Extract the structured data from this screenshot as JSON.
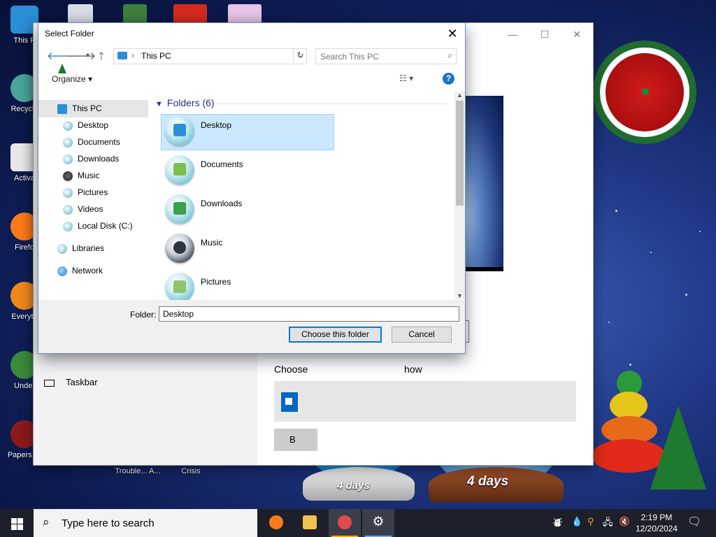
{
  "desktop": {
    "icons": [
      {
        "label": "This P",
        "color": "#2a8fd6"
      },
      {
        "label": "Recycle",
        "color": "#4aa59a"
      },
      {
        "label": "Activa",
        "color": "#e8e8e8"
      },
      {
        "label": "Firefo",
        "color": "#ff7a1a"
      },
      {
        "label": "Everyth",
        "color": "#f08a1c"
      },
      {
        "label": "Under",
        "color": "#3a8a3a"
      },
      {
        "label": "Papers, P",
        "color": "#8b1a1a"
      }
    ],
    "bottom_labels": [
      "Trouble... A...",
      "Crisis"
    ]
  },
  "settings_window": {
    "taskbar_label": "Taskbar",
    "choose_text": "Choose",
    "show_text": "how",
    "browse_label": "B"
  },
  "dialog": {
    "title": "Select Folder",
    "address": "This PC",
    "search_placeholder": "Search This PC",
    "organize_label": "Organize ▾",
    "help_label": "?",
    "tree": [
      {
        "label": "This PC",
        "color": "#2a8fd6"
      },
      {
        "label": "Desktop",
        "color": "#2a8fd6"
      },
      {
        "label": "Documents",
        "color": "#7cbf4a"
      },
      {
        "label": "Downloads",
        "color": "#3aa04a"
      },
      {
        "label": "Music",
        "color": "#333333"
      },
      {
        "label": "Pictures",
        "color": "#8ec46a"
      },
      {
        "label": "Videos",
        "color": "#3ab0c8"
      },
      {
        "label": "Local Disk (C:)",
        "color": "#9ab8c8"
      },
      {
        "label": "Libraries",
        "color": "#5aa0b8"
      },
      {
        "label": "Network",
        "color": "#2a7fd0"
      }
    ],
    "folders_header": "Folders (6)",
    "folders": [
      {
        "label": "Desktop",
        "color": "#2a8fd6",
        "selected": true
      },
      {
        "label": "Documents",
        "color": "#7cbf4a",
        "selected": false
      },
      {
        "label": "Downloads",
        "color": "#3aa04a",
        "selected": false
      },
      {
        "label": "Music",
        "color": "#2e3440",
        "selected": false
      },
      {
        "label": "Pictures",
        "color": "#8ec46a",
        "selected": false
      }
    ],
    "folder_label": "Folder:",
    "folder_value": "Desktop",
    "choose_button": "Choose this folder",
    "cancel_button": "Cancel"
  },
  "decorations": {
    "globe1_text": "4 days",
    "globe2_text": "4 days"
  },
  "taskbar": {
    "search_placeholder": "Type here to search",
    "time": "2:19 PM",
    "date": "12/20/2024",
    "accent": "#f6a623"
  }
}
